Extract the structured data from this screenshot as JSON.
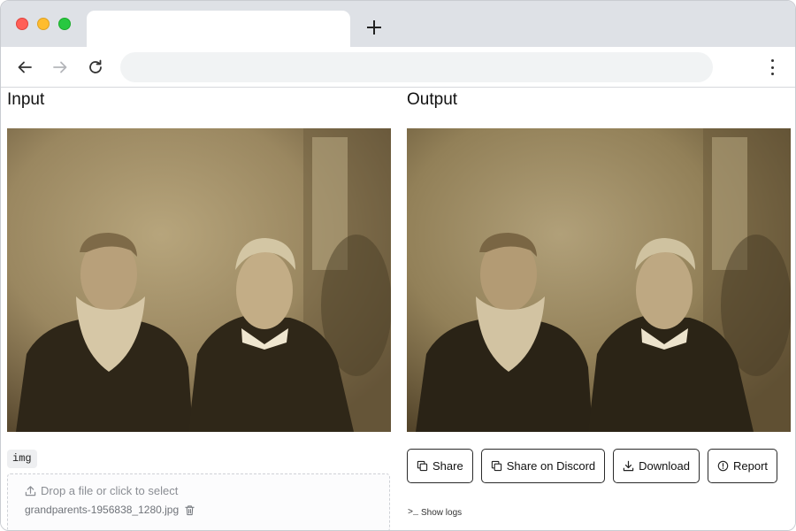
{
  "browser": {
    "tab_title": "",
    "new_tab_symbol": "+",
    "address": "",
    "icons": {
      "back": "arrow-left-icon",
      "forward": "arrow-right-icon",
      "reload": "reload-icon",
      "menu": "vertical-dots-icon"
    },
    "traffic_colors": {
      "close": "#ff5f57",
      "minimize": "#febc2e",
      "maximize": "#28c840"
    }
  },
  "input_panel": {
    "title": "Input",
    "image_description": "sepia vintage photograph of two men",
    "component_label": "img",
    "drop_hint": "Drop a file or click to select",
    "file_name": "grandparents-1956838_1280.jpg"
  },
  "output_panel": {
    "title": "Output",
    "image_description": "sepia vintage photograph of two men (restored)",
    "buttons": {
      "share": "Share",
      "share_discord": "Share on Discord",
      "download": "Download",
      "report": "Report"
    },
    "show_logs": "Show logs",
    "show_logs_prefix": ">_"
  }
}
